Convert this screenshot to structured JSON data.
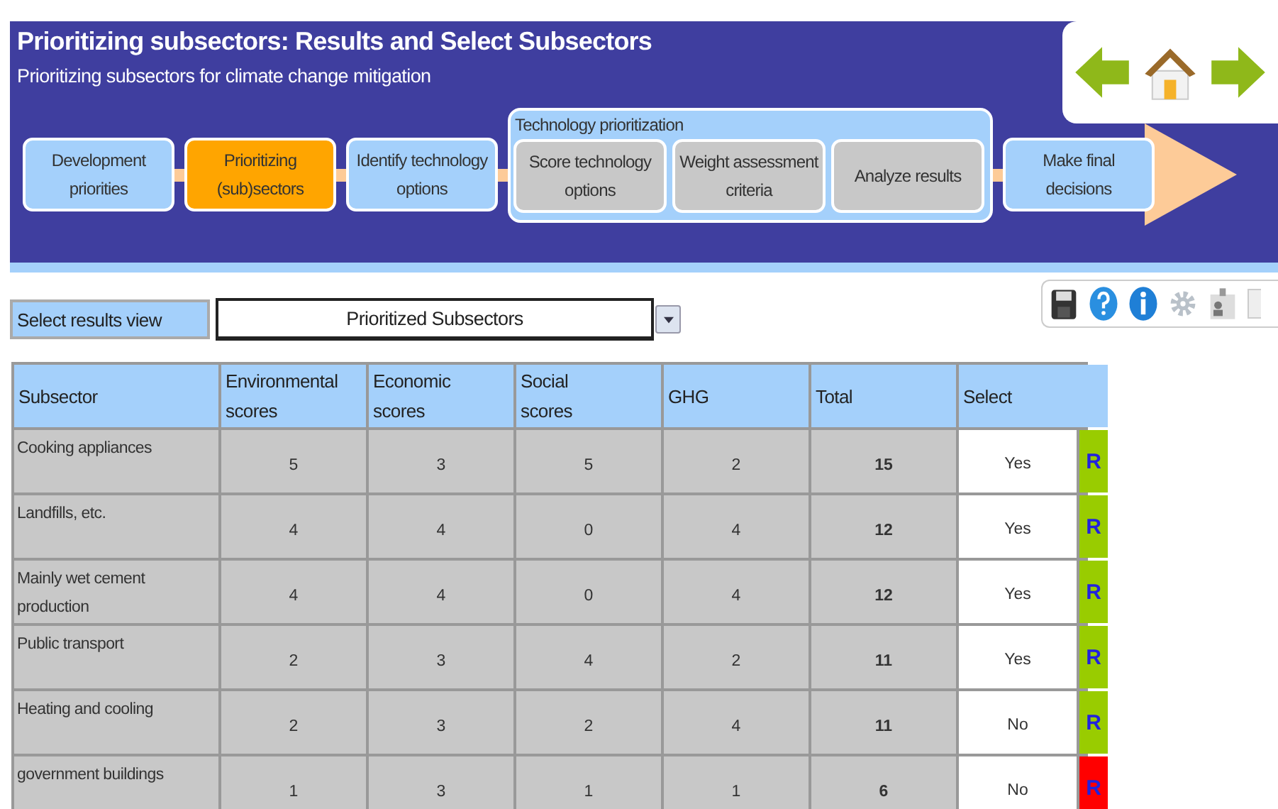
{
  "header": {
    "title": "Prioritizing subsectors: Results and Select Subsectors",
    "subtitle": "Prioritizing subsectors for climate change mitigation"
  },
  "steps": [
    {
      "kind": "step",
      "label": "Development priorities",
      "selected": false
    },
    {
      "kind": "step",
      "label": "Prioritizing (sub)sectors",
      "selected": true
    },
    {
      "kind": "step",
      "label": "Identify technology options",
      "selected": false
    },
    {
      "kind": "group",
      "label": "Technology prioritization",
      "steps": [
        {
          "kind": "substep",
          "label": "Score  technology options",
          "selected": false
        },
        {
          "kind": "substep",
          "label": "Weight assessment criteria",
          "selected": false
        },
        {
          "kind": "substep",
          "label": "Analyze results",
          "selected": false
        }
      ]
    },
    {
      "kind": "step",
      "label": "Make final decisions",
      "selected": false
    }
  ],
  "results_view": {
    "label": "Select results view",
    "value": "Prioritized Subsectors"
  },
  "table": {
    "columns": [
      "Subsector",
      "Environmental scores",
      "Economic scores",
      "Social scores",
      "GHG",
      "Total",
      "Select"
    ],
    "rows": [
      {
        "subsector": "Cooking appliances",
        "environmental": "5",
        "economic": "3",
        "social": "5",
        "ghg": "2",
        "total": "15",
        "select": "Yes",
        "flag": "R",
        "color": "#99cc00"
      },
      {
        "subsector": "Landfills, etc.",
        "environmental": "4",
        "economic": "4",
        "social": "0",
        "ghg": "4",
        "total": "12",
        "select": "Yes",
        "flag": "R",
        "color": "#99cc00"
      },
      {
        "subsector": "Mainly wet cement production",
        "environmental": "4",
        "economic": "4",
        "social": "0",
        "ghg": "4",
        "total": "12",
        "select": "Yes",
        "flag": "R",
        "color": "#99cc00"
      },
      {
        "subsector": "Public transport",
        "environmental": "2",
        "economic": "3",
        "social": "4",
        "ghg": "2",
        "total": "11",
        "select": "Yes",
        "flag": "R",
        "color": "#99cc00"
      },
      {
        "subsector": "Heating and cooling",
        "environmental": "2",
        "economic": "3",
        "social": "2",
        "ghg": "4",
        "total": "11",
        "select": "No",
        "flag": "R",
        "color": "#99cc00"
      },
      {
        "subsector": "government buildings",
        "environmental": "1",
        "economic": "3",
        "social": "1",
        "ghg": "1",
        "total": "6",
        "select": "No",
        "flag": "R",
        "color": "#ff0000"
      }
    ]
  }
}
